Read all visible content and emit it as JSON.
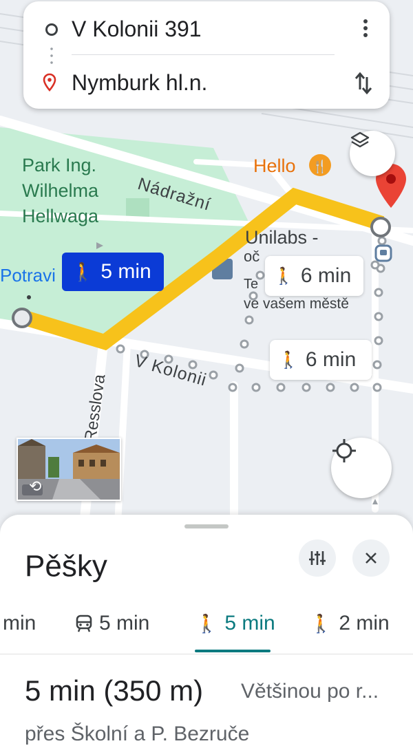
{
  "route": {
    "origin": "V Kolonii 391",
    "destination": "Nymburk hl.n."
  },
  "map": {
    "park_label": [
      "Park Ing.",
      "Wilhelma",
      "Hellwaga"
    ],
    "street_nadrazni": "Nádražní",
    "street_v_kolonii": "V Kolonii",
    "street_resslova": "Resslova",
    "poi_hello": "Hello",
    "poi_unilabs_line1": "Unilabs -",
    "poi_unilabs_line2": "oč",
    "poi_unilabs_line3": "Te",
    "poi_unilabs_line4": "ve vašem městě",
    "poi_potravi": "Potravi",
    "selected_route_time": "5 min",
    "alt_route_time_1": "6 min",
    "alt_route_time_2": "6 min",
    "colors": {
      "route": "#f7c21b",
      "park": "#c6eed6",
      "selected_chip": "#0b3bd6",
      "pin": "#ea4335",
      "poi_orange": "#e8710a"
    }
  },
  "sheet": {
    "title": "Pěšky",
    "tabs": [
      {
        "label": "min",
        "icon": "car-icon"
      },
      {
        "label": "5 min",
        "icon": "transit-icon"
      },
      {
        "label": "5 min",
        "icon": "walk-icon",
        "active": true
      },
      {
        "label": "2 min",
        "icon": "ride-icon"
      }
    ],
    "summary_time": "5 min",
    "summary_distance": "(350 m)",
    "summary_note": "Většinou po r...",
    "via": "přes Školní a P. Bezruče"
  }
}
